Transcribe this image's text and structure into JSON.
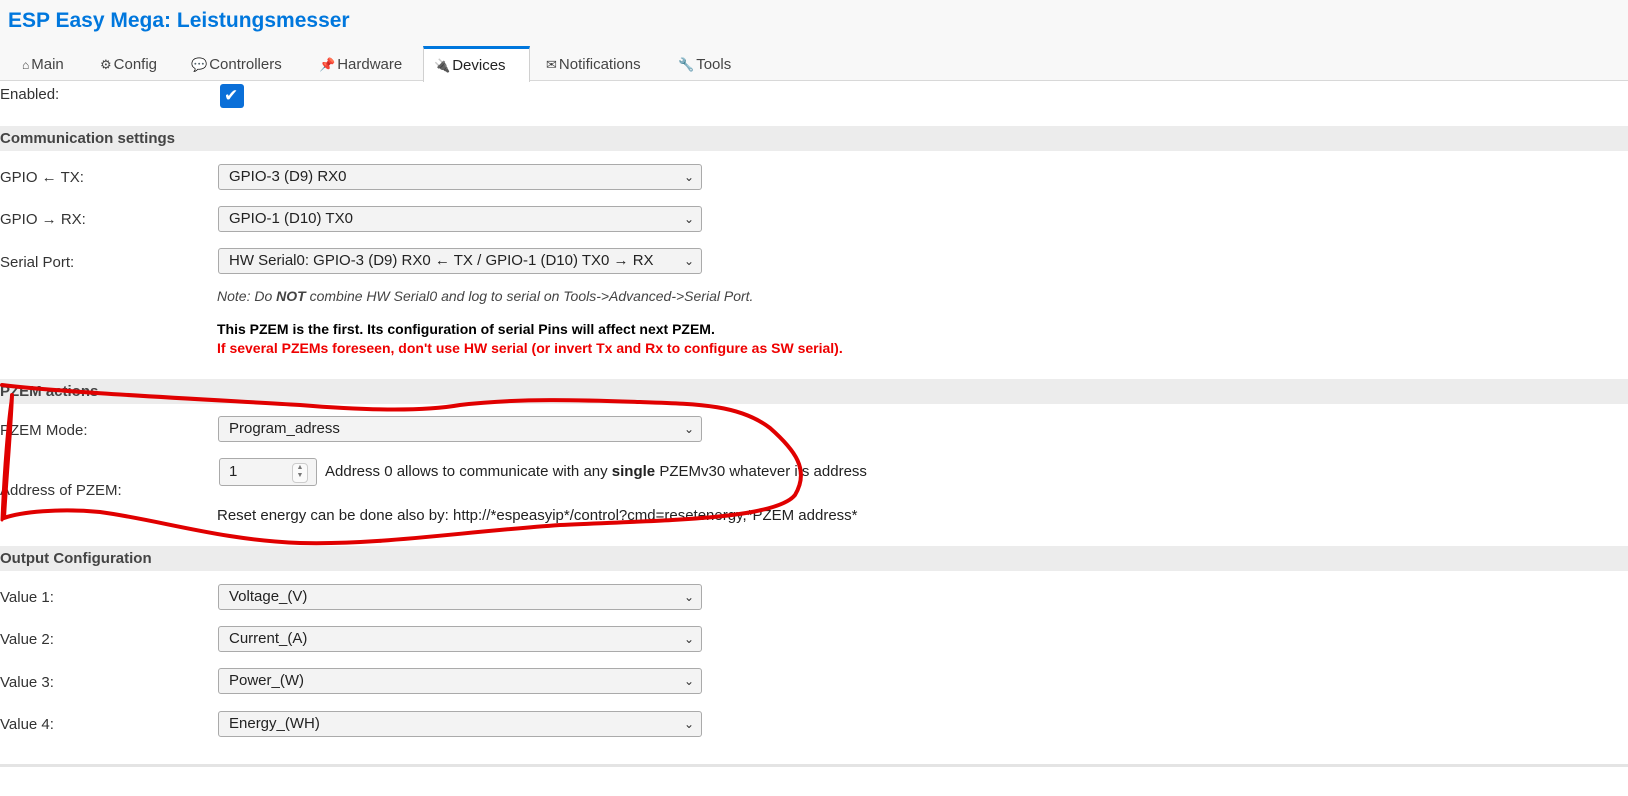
{
  "app_title": "ESP Easy Mega: Leistungsmesser",
  "tabs": [
    {
      "label": "Main",
      "icon": "home-icon",
      "glyph": "⌂"
    },
    {
      "label": "Config",
      "icon": "gear-icon",
      "glyph": "⚙"
    },
    {
      "label": "Controllers",
      "icon": "chat-icon",
      "glyph": "💬"
    },
    {
      "label": "Hardware",
      "icon": "pin-icon",
      "glyph": "📌"
    },
    {
      "label": "Devices",
      "icon": "plug-icon",
      "glyph": "🔌",
      "active": true
    },
    {
      "label": "Notifications",
      "icon": "mail-icon",
      "glyph": "✉"
    },
    {
      "label": "Tools",
      "icon": "wrench-icon",
      "glyph": "🔧"
    }
  ],
  "enabled": {
    "label": "Enabled:",
    "checked": true,
    "check_glyph": "✔"
  },
  "communication": {
    "heading": "Communication settings",
    "gpio_tx": {
      "label": "GPIO ← TX:",
      "value": "GPIO-3 (D9) RX0"
    },
    "gpio_rx": {
      "label": "GPIO → RX:",
      "value": "GPIO-1 (D10) TX0"
    },
    "serial_port": {
      "label": "Serial Port:",
      "value": "HW Serial0: GPIO-3 (D9) RX0 ← TX / GPIO-1 (D10) TX0 → RX"
    },
    "note_prefix": "Note: Do ",
    "note_bold": "NOT",
    "note_suffix": " combine HW Serial0 and log to serial on Tools->Advanced->Serial Port.",
    "first_pzem_msg": "This PZEM is the first. Its configuration of serial Pins will affect next PZEM.",
    "warning_msg": "If several PZEMs foreseen, don't use HW serial (or invert Tx and Rx to configure as SW serial)."
  },
  "pzem_actions": {
    "heading": "PZEM actions",
    "mode": {
      "label": "PZEM Mode:",
      "value": "Program_adress"
    },
    "address": {
      "label": "Address of PZEM:",
      "value": "1",
      "hint_prefix": "Address 0 allows to communicate with any ",
      "hint_bold": "single",
      "hint_suffix": " PZEMv30 whatever its address"
    },
    "reset_text": "Reset energy can be done also by: http://*espeasyip*/control?cmd=resetenergy,*PZEM address*"
  },
  "output": {
    "heading": "Output Configuration",
    "values": [
      {
        "label": "Value 1:",
        "value": "Voltage_(V)"
      },
      {
        "label": "Value 2:",
        "value": "Current_(A)"
      },
      {
        "label": "Value 3:",
        "value": "Power_(W)"
      },
      {
        "label": "Value 4:",
        "value": "Energy_(WH)"
      }
    ]
  },
  "chevron_glyph": "⌄",
  "spinner_glyphs": {
    "up": "▲",
    "down": "▼"
  },
  "colors": {
    "accent": "#0077dd",
    "warning": "#ee0000",
    "annotation": "#e00000",
    "section_bg": "#ececec"
  }
}
